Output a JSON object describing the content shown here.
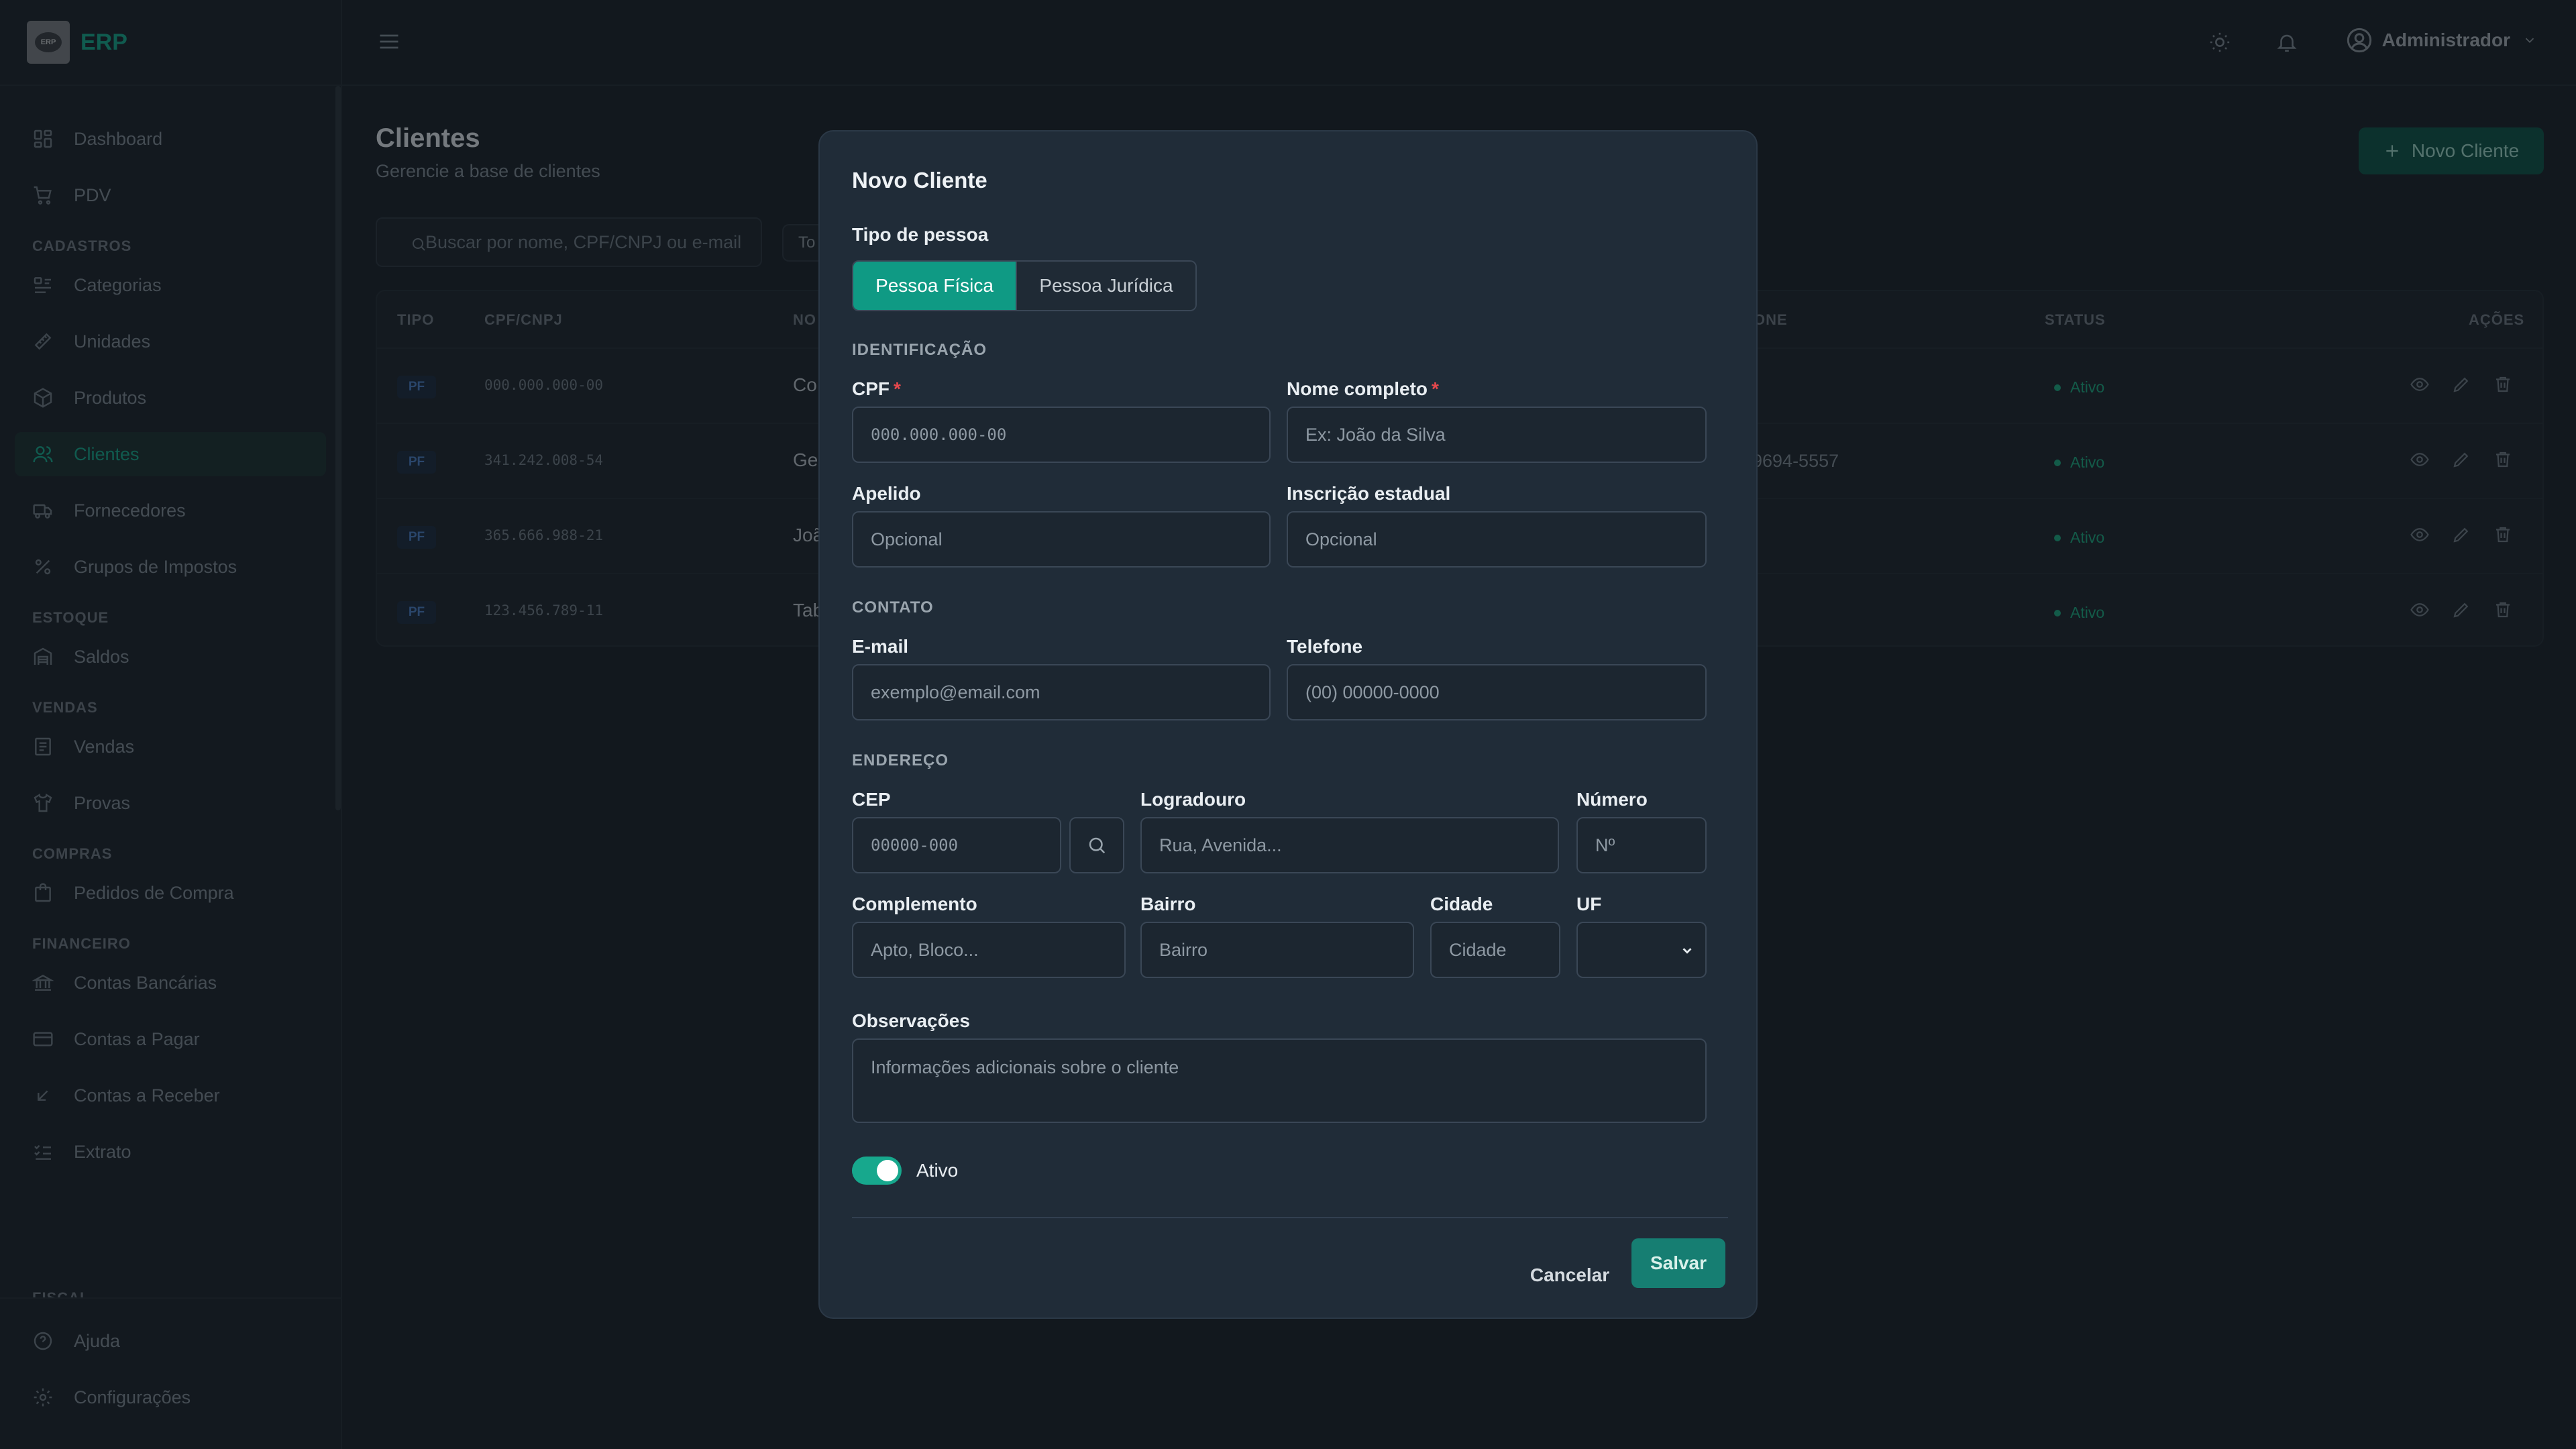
{
  "brand": {
    "logo_text": "ERP",
    "name": "ERP",
    "accent": "#17a88d"
  },
  "sidebar": {
    "top_items": [
      {
        "label": "Dashboard",
        "icon": "dashboard-icon"
      },
      {
        "label": "PDV",
        "icon": "cart-icon"
      }
    ],
    "sections": [
      {
        "title": "CADASTROS",
        "items": [
          {
            "label": "Categorias",
            "icon": "list-icon"
          },
          {
            "label": "Unidades",
            "icon": "ruler-icon"
          },
          {
            "label": "Produtos",
            "icon": "package-icon"
          },
          {
            "label": "Clientes",
            "icon": "users-icon",
            "active": true
          },
          {
            "label": "Fornecedores",
            "icon": "truck-icon"
          },
          {
            "label": "Grupos de Impostos",
            "icon": "percent-icon"
          }
        ]
      },
      {
        "title": "ESTOQUE",
        "items": [
          {
            "label": "Saldos",
            "icon": "warehouse-icon"
          }
        ]
      },
      {
        "title": "VENDAS",
        "items": [
          {
            "label": "Vendas",
            "icon": "receipt-icon"
          },
          {
            "label": "Provas",
            "icon": "shirt-icon"
          }
        ]
      },
      {
        "title": "COMPRAS",
        "items": [
          {
            "label": "Pedidos de Compra",
            "icon": "shopping-bag-icon"
          }
        ]
      },
      {
        "title": "FINANCEIRO",
        "items": [
          {
            "label": "Contas Bancárias",
            "icon": "bank-icon"
          },
          {
            "label": "Contas a Pagar",
            "icon": "credit-card-icon"
          },
          {
            "label": "Contas a Receber",
            "icon": "arrow-down-left-icon"
          },
          {
            "label": "Extrato",
            "icon": "list-checks-icon"
          }
        ]
      }
    ],
    "partial_section": "FISCAL",
    "bottom_items": [
      {
        "label": "Ajuda",
        "icon": "help-circle-icon"
      },
      {
        "label": "Configurações",
        "icon": "gear-icon"
      }
    ]
  },
  "header": {
    "user_name": "Administrador"
  },
  "page": {
    "title": "Clientes",
    "subtitle": "Gerencie a base de clientes",
    "new_button": "Novo Cliente",
    "search_placeholder": "Buscar por nome, CPF/CNPJ ou e-mail",
    "filter_peek": "To"
  },
  "table": {
    "headers": {
      "tipo": "TIPO",
      "doc": "CPF/CNPJ",
      "nome": "NO",
      "telefone": "ONE",
      "status": "STATUS",
      "acoes": "AÇÕES"
    },
    "rows": [
      {
        "tipo": "PF",
        "doc": "000.000.000-00",
        "nome": "Co",
        "telefone": "",
        "status": "Ativo"
      },
      {
        "tipo": "PF",
        "doc": "341.242.008-54",
        "nome": "Ge",
        "telefone": "9694-5557",
        "status": "Ativo"
      },
      {
        "tipo": "PF",
        "doc": "365.666.988-21",
        "nome": "Joã",
        "telefone": "",
        "status": "Ativo"
      },
      {
        "tipo": "PF",
        "doc": "123.456.789-11",
        "nome": "Tab",
        "telefone": "",
        "status": "Ativo"
      }
    ]
  },
  "modal": {
    "title": "Novo Cliente",
    "tipo_label": "Tipo de pessoa",
    "tipo_options": [
      "Pessoa Física",
      "Pessoa Jurídica"
    ],
    "sections": {
      "identificacao": "IDENTIFICAÇÃO",
      "contato": "CONTATO",
      "endereco": "ENDEREÇO"
    },
    "fields": {
      "cpf": {
        "label": "CPF",
        "required": "*",
        "placeholder": "000.000.000-00"
      },
      "nome": {
        "label": "Nome completo",
        "required": "*",
        "placeholder": "Ex: João da Silva"
      },
      "apelido": {
        "label": "Apelido",
        "placeholder": "Opcional"
      },
      "ie": {
        "label": "Inscrição estadual",
        "placeholder": "Opcional"
      },
      "email": {
        "label": "E-mail",
        "placeholder": "exemplo@email.com"
      },
      "telefone": {
        "label": "Telefone",
        "placeholder": "(00) 00000-0000"
      },
      "cep": {
        "label": "CEP",
        "placeholder": "00000-000"
      },
      "logradouro": {
        "label": "Logradouro",
        "placeholder": "Rua, Avenida..."
      },
      "numero": {
        "label": "Número",
        "placeholder": "Nº"
      },
      "complemento": {
        "label": "Complemento",
        "placeholder": "Apto, Bloco..."
      },
      "bairro": {
        "label": "Bairro",
        "placeholder": "Bairro"
      },
      "cidade": {
        "label": "Cidade",
        "placeholder": "Cidade"
      },
      "uf": {
        "label": "UF",
        "value": ""
      },
      "observacoes": {
        "label": "Observações",
        "placeholder": "Informações adicionais sobre o cliente"
      }
    },
    "active_label": "Ativo",
    "active": true,
    "cancel_label": "Cancelar",
    "save_label": "Salvar"
  }
}
